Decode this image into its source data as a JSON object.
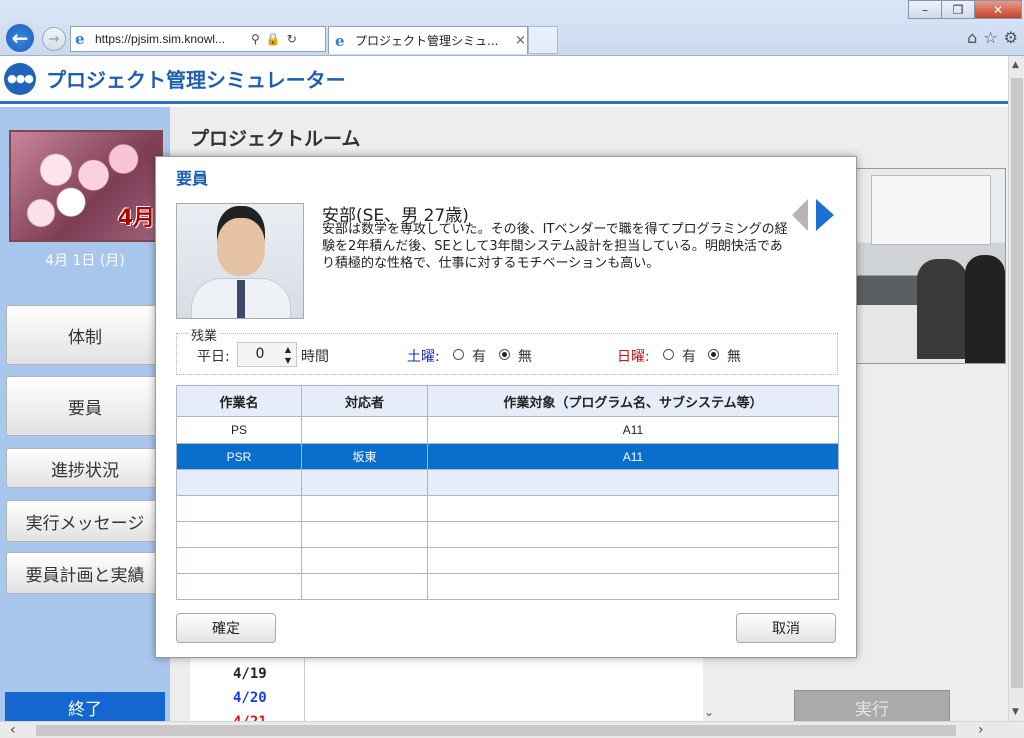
{
  "browser": {
    "window_title": "Internet Explorer",
    "url": "https://pjsim.sim.knowl...",
    "tab_title": "プロジェクト管理シミュ...",
    "tab_close": "×",
    "back_icon": "back-arrow-icon",
    "forward_icon": "forward-arrow-icon"
  },
  "app": {
    "title": "プロジェクト管理シミュレーター",
    "logo_text": "●●●"
  },
  "sidebar": {
    "month_label": "4月",
    "current_date": "4月 1日 (月)",
    "items": [
      {
        "label": "体制"
      },
      {
        "label": "要員"
      },
      {
        "label": "進捗状況"
      },
      {
        "label": "実行メッセージ"
      },
      {
        "label": "要員計画と実績"
      }
    ],
    "exit_label": "終了"
  },
  "main": {
    "room_title": "プロジェクトルーム",
    "dates": [
      {
        "label": "4/19",
        "color": "#222222"
      },
      {
        "label": "4/20",
        "color": "#1a3fd0"
      },
      {
        "label": "4/21",
        "color": "#d01a1a"
      }
    ],
    "execute_label": "実行"
  },
  "modal": {
    "title": "要員",
    "member": {
      "name": "安部(SE、男 27歳)",
      "description": "安部は数学を専攻していた。その後、ITベンダーで職を得てプログラミングの経験を2年積んだ後、SEとして3年間システム設計を担当している。明朗快活であり積極的な性格で、仕事に対するモチベーションも高い。"
    },
    "overtime": {
      "legend": "残業",
      "weekday_label": "平日:",
      "weekday_value": "0",
      "unit": "時間",
      "saturday_label": "土曜:",
      "saturday_color": "#1a2fb8",
      "sunday_label": "日曜:",
      "sunday_color": "#c81414",
      "yes_label": "有",
      "no_label": "無",
      "saturday_selected": "無",
      "sunday_selected": "無"
    },
    "table": {
      "headers": [
        "作業名",
        "対応者",
        "作業対象（プログラム名、サブシステム等）"
      ],
      "rows": [
        {
          "task": "PS",
          "assignee": "",
          "target": "A11"
        },
        {
          "task": "PSR",
          "assignee": "坂東",
          "target": "A11"
        },
        {
          "task": "",
          "assignee": "",
          "target": ""
        },
        {
          "task": "",
          "assignee": "",
          "target": ""
        },
        {
          "task": "",
          "assignee": "",
          "target": ""
        },
        {
          "task": "",
          "assignee": "",
          "target": ""
        },
        {
          "task": "",
          "assignee": "",
          "target": ""
        }
      ],
      "selected_row": 1,
      "hover_row": 2
    },
    "confirm_label": "確定",
    "cancel_label": "取消"
  }
}
